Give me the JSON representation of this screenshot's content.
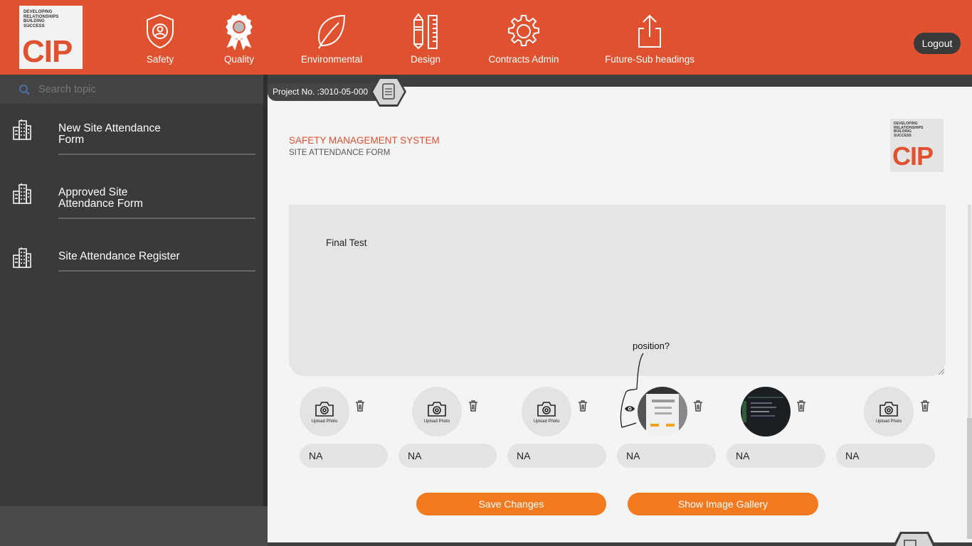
{
  "header": {
    "logo": {
      "tagline": [
        "DEVELOPING",
        "RELATIONSHIPS",
        "BUILDING",
        "SUCCESS"
      ],
      "mark": "CIP"
    },
    "nav": [
      {
        "label": "Safety",
        "icon": "shield-user-icon"
      },
      {
        "label": "Quality",
        "icon": "award-ribbon-icon"
      },
      {
        "label": "Environmental",
        "icon": "leaf-icon"
      },
      {
        "label": "Design",
        "icon": "pencil-ruler-icon"
      },
      {
        "label": "Contracts Admin",
        "icon": "gear-icon"
      },
      {
        "label": "Future-Sub headings",
        "icon": "share-upload-icon"
      }
    ],
    "logout_label": "Logout"
  },
  "sidebar": {
    "search_placeholder": "Search topic",
    "items": [
      {
        "label_line1": "New Site Attendance",
        "label_line2": "Form",
        "icon": "building-icon"
      },
      {
        "label_line1": "Approved Site",
        "label_line2": "Attendance Form",
        "icon": "building-icon"
      },
      {
        "label_line1": "Site Attendance Register",
        "label_line2": "",
        "icon": "building-icon"
      }
    ]
  },
  "main": {
    "project_no": "Project No. :3010-05-000",
    "title": "SAFETY MANAGEMENT SYSTEM",
    "subtitle": "SITE ATTENDANCE FORM",
    "textarea_value": "Final Test",
    "annotation": "position?",
    "photos": [
      {
        "type": "upload",
        "label": "Upload Photo",
        "caption": "NA"
      },
      {
        "type": "upload",
        "label": "Upload Photo",
        "caption": "NA"
      },
      {
        "type": "upload",
        "label": "Upload Photo",
        "caption": "NA"
      },
      {
        "type": "image-light",
        "label": "",
        "caption": "NA"
      },
      {
        "type": "image-dark",
        "label": "",
        "caption": "NA"
      },
      {
        "type": "upload",
        "label": "Upload Photo",
        "caption": "NA"
      }
    ],
    "save_label": "Save Changes",
    "gallery_label": "Show Image Gallery"
  },
  "colors": {
    "brand": "#e0522f",
    "button": "#f47a20",
    "sidebar": "#3a3a3a"
  }
}
